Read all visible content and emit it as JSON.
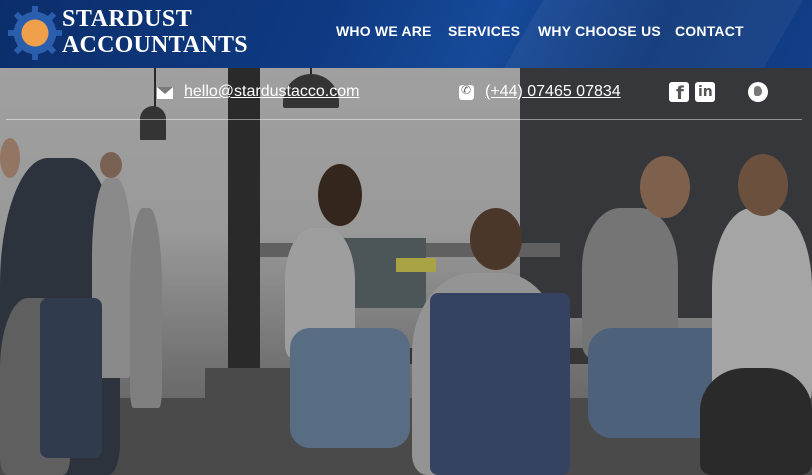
{
  "brand": {
    "line1": "STARDUST",
    "line2": "ACCOUNTANTS"
  },
  "nav": [
    {
      "label": "WHO WE ARE"
    },
    {
      "label": "SERVICES"
    },
    {
      "label": "WHY CHOOSE US"
    },
    {
      "label": "CONTACT"
    }
  ],
  "contact": {
    "email": "hello@stardustacco.com",
    "phone": "(+44) 07465 07834",
    "icons": [
      "mail-icon",
      "phone-icon",
      "facebook-icon",
      "linkedin-icon",
      "globe-icon"
    ]
  },
  "colors": {
    "header": "#0f3a82",
    "logo_gear": "#2b5fae",
    "logo_sun": "#f0a04b"
  }
}
